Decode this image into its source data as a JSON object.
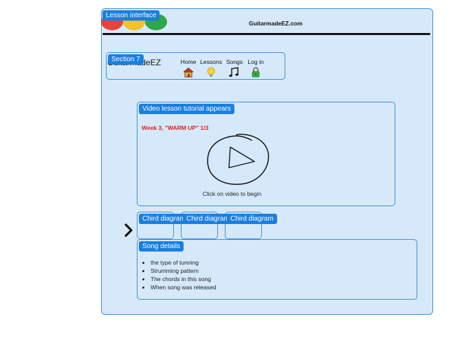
{
  "frame": {
    "label": "Lesson interface"
  },
  "header": {
    "site_title": "GuitarmadeEZ.com",
    "dots": [
      {
        "name": "red-dot",
        "color": "#e8443a"
      },
      {
        "name": "yellow-dot",
        "color": "#f4c02b"
      },
      {
        "name": "green-dot",
        "color": "#2ea84a"
      }
    ]
  },
  "section": {
    "label": "Section 7",
    "brand": "GuitarmadeEZ",
    "nav": [
      {
        "label": "Home",
        "icon": "house-icon"
      },
      {
        "label": "Lessons",
        "icon": "lightbulb-icon"
      },
      {
        "label": "Songs",
        "icon": "music-note-icon"
      },
      {
        "label": "Log in",
        "icon": "lock-icon"
      }
    ]
  },
  "video": {
    "label": "Video lesson tutorial appears",
    "week_title": "Week 3, \"WARM UP\" 1/3",
    "caption": "Click on video to begin"
  },
  "chords": {
    "arrow_icon": "chevron-right-icon",
    "cards": [
      {
        "label": "Chird diagram"
      },
      {
        "label": "Chird diagram"
      },
      {
        "label": "Chird diagram"
      }
    ]
  },
  "details": {
    "label": "Song details",
    "items": [
      "the type of tunning",
      "Strumming pattern",
      "The chords in this song",
      "When song was released"
    ]
  },
  "colors": {
    "panel_bg": "#d6e9fb",
    "panel_border": "#3b8fdc",
    "tag_bg": "#1a7fe0",
    "week_title": "#e0201c"
  }
}
